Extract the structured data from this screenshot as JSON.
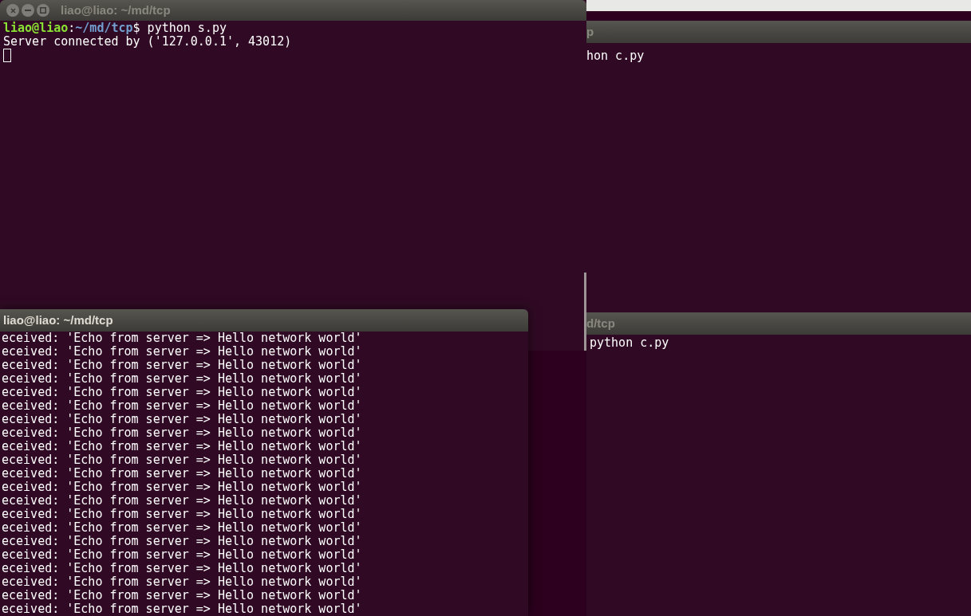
{
  "windows": [
    {
      "title": "liao@liao: ~/md/tcp",
      "focused": false,
      "buttons": true,
      "cursor": true,
      "scrollbar": true,
      "lines": [
        {
          "kind": "prompt",
          "user_host": "liao@liao",
          "separator": ":",
          "path": "~/md/tcp",
          "symbol": "$",
          "command": "python s.py"
        },
        {
          "kind": "output",
          "text": "Server connected by ('127.0.0.1', 43012)"
        }
      ]
    },
    {
      "title": "p",
      "focused": false,
      "lines": [
        {
          "kind": "output",
          "text": "hon c.py"
        }
      ]
    },
    {
      "title": "liao@liao: ~/md/tcp",
      "focused": true,
      "lines": [
        {
          "kind": "output",
          "text": "eceived: 'Echo from server => Hello network world'"
        },
        {
          "kind": "output",
          "text": "eceived: 'Echo from server => Hello network world'"
        },
        {
          "kind": "output",
          "text": "eceived: 'Echo from server => Hello network world'"
        },
        {
          "kind": "output",
          "text": "eceived: 'Echo from server => Hello network world'"
        },
        {
          "kind": "output",
          "text": "eceived: 'Echo from server => Hello network world'"
        },
        {
          "kind": "output",
          "text": "eceived: 'Echo from server => Hello network world'"
        },
        {
          "kind": "output",
          "text": "eceived: 'Echo from server => Hello network world'"
        },
        {
          "kind": "output",
          "text": "eceived: 'Echo from server => Hello network world'"
        },
        {
          "kind": "output",
          "text": "eceived: 'Echo from server => Hello network world'"
        },
        {
          "kind": "output",
          "text": "eceived: 'Echo from server => Hello network world'"
        },
        {
          "kind": "output",
          "text": "eceived: 'Echo from server => Hello network world'"
        },
        {
          "kind": "output",
          "text": "eceived: 'Echo from server => Hello network world'"
        },
        {
          "kind": "output",
          "text": "eceived: 'Echo from server => Hello network world'"
        },
        {
          "kind": "output",
          "text": "eceived: 'Echo from server => Hello network world'"
        },
        {
          "kind": "output",
          "text": "eceived: 'Echo from server => Hello network world'"
        },
        {
          "kind": "output",
          "text": "eceived: 'Echo from server => Hello network world'"
        },
        {
          "kind": "output",
          "text": "eceived: 'Echo from server => Hello network world'"
        },
        {
          "kind": "output",
          "text": "eceived: 'Echo from server => Hello network world'"
        },
        {
          "kind": "output",
          "text": "eceived: 'Echo from server => Hello network world'"
        },
        {
          "kind": "output",
          "text": "eceived: 'Echo from server => Hello network world'"
        },
        {
          "kind": "output",
          "text": "eceived: 'Echo from server => Hello network world'"
        }
      ]
    },
    {
      "title": "d/tcp",
      "focused": false,
      "lines": [
        {
          "kind": "output",
          "text": "python c.py"
        }
      ]
    }
  ]
}
